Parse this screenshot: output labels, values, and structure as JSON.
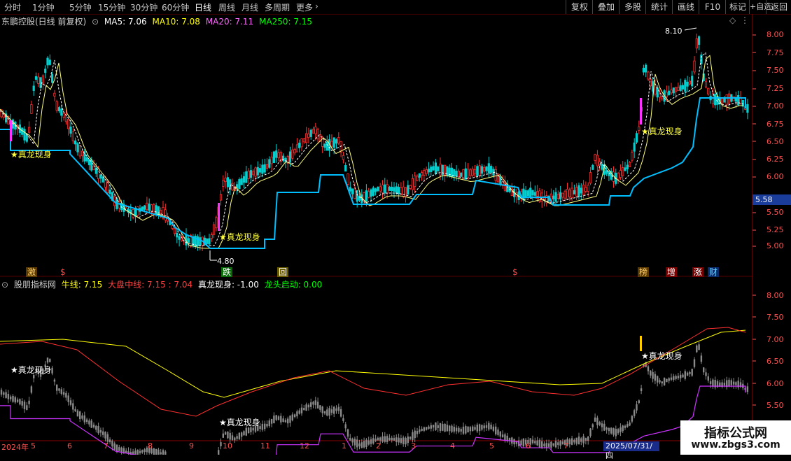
{
  "toolbar": {
    "periods": [
      "分时",
      "1分钟",
      "5分钟",
      "15分钟",
      "30分钟",
      "60分钟",
      "日线",
      "周线",
      "月线",
      "多周期",
      "更多"
    ],
    "active_period": "日线",
    "buttons": [
      "复权",
      "叠加",
      "多股",
      "统计",
      "画线",
      "F10",
      "标记",
      "+自选",
      "返回"
    ]
  },
  "main": {
    "title": "东鹏控股(日线 前复权)",
    "ma": [
      {
        "label": "MA5: 7.06",
        "color": "#ffffff"
      },
      {
        "label": "MA10: 7.08",
        "color": "#ffff00"
      },
      {
        "label": "MA20: 7.11",
        "color": "#ff66ff"
      },
      {
        "label": "MA250: 7.15",
        "color": "#00ff00"
      }
    ],
    "y_ticks": [
      "8.00",
      "7.75",
      "7.50",
      "7.25",
      "7.00",
      "6.75",
      "6.50",
      "6.25",
      "6.00",
      "5.75",
      "5.50",
      "5.25",
      "5.00"
    ],
    "price_tag": "5.58",
    "high_label": "8.10",
    "low_label": "4.80",
    "signals": [
      "★真龙现身",
      "★真龙现身",
      "★真龙现身"
    ],
    "badges": [
      {
        "text": "激",
        "color": "#ffcc66",
        "bg": "#5a3a00"
      },
      {
        "text": "$",
        "color": "#ff4040",
        "bg": ""
      },
      {
        "text": "跌",
        "color": "#ffffff",
        "bg": "#0a6a0a"
      },
      {
        "text": "回",
        "color": "#ffffff",
        "bg": "#6a5a00"
      },
      {
        "text": "$",
        "color": "#ff4040",
        "bg": ""
      },
      {
        "text": "榜",
        "color": "#ffcc66",
        "bg": "#5a3a00"
      },
      {
        "text": "增",
        "color": "#ffffff",
        "bg": "#7a0000"
      },
      {
        "text": "涨",
        "color": "#ffffff",
        "bg": "#7a0000"
      },
      {
        "text": "财",
        "color": "#66ccff",
        "bg": "#0a2a6a"
      }
    ]
  },
  "sub": {
    "title": "股朋指标网",
    "items": [
      {
        "label": "牛线: 7.15",
        "color": "#ffff00"
      },
      {
        "label": "大盘中线: 7.15 : 7.04",
        "color": "#ff4040"
      },
      {
        "label": "真龙现身: -1.00",
        "color": "#ffffff"
      },
      {
        "label": "龙头启动: 0.00",
        "color": "#00ff00"
      }
    ],
    "y_ticks": [
      "8.00",
      "7.50",
      "7.00",
      "6.50",
      "6.00",
      "5.50"
    ],
    "signals": [
      "★真龙现身",
      "★真龙现身",
      "★真龙现身"
    ]
  },
  "dates": {
    "ticks": [
      "2024年",
      "5",
      "6",
      "7",
      "8",
      "9",
      "10",
      "11",
      "12",
      "1",
      "2",
      "3",
      "4",
      "5",
      "6",
      "7"
    ],
    "highlight": "2025/07/31/四"
  },
  "watermark": {
    "title": "指标公式网",
    "url": "www.zbgs3.com"
  },
  "colors": {
    "up": "#ff3030",
    "down": "#00d0d0",
    "support": "#00bfff",
    "support2": "#cc33ff",
    "bull": "#ffff00"
  }
}
